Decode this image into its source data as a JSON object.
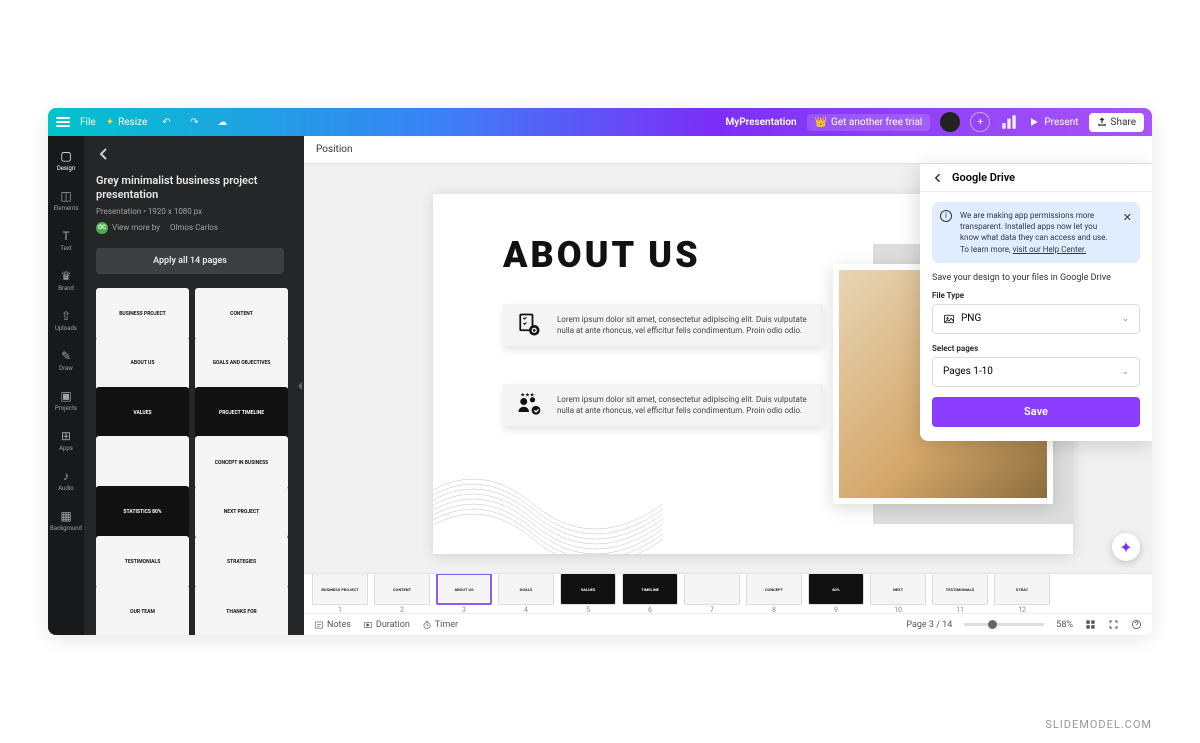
{
  "topbar": {
    "file": "File",
    "resize": "Resize",
    "doc_title": "MyPresentation",
    "trial": "Get another free trial",
    "present": "Present",
    "share": "Share"
  },
  "rail": {
    "items": [
      {
        "label": "Design"
      },
      {
        "label": "Elements"
      },
      {
        "label": "Text"
      },
      {
        "label": "Brand"
      },
      {
        "label": "Uploads"
      },
      {
        "label": "Draw"
      },
      {
        "label": "Projects"
      },
      {
        "label": "Apps"
      },
      {
        "label": "Audio"
      },
      {
        "label": "Background"
      }
    ]
  },
  "panel": {
    "title": "Grey minimalist business project presentation",
    "subtitle": "Presentation • 1920 x 1080 px",
    "author_prefix": "View more by",
    "author": "Olmos Carlos",
    "author_badge": "OC",
    "apply": "Apply all 14 pages",
    "thumbs": [
      {
        "label": "BUSINESS PROJECT",
        "dark": false
      },
      {
        "label": "CONTENT",
        "dark": false
      },
      {
        "label": "ABOUT US",
        "dark": false
      },
      {
        "label": "GOALS AND OBJECTIVES",
        "dark": false
      },
      {
        "label": "VALUES",
        "dark": true
      },
      {
        "label": "PROJECT TIMELINE",
        "dark": true
      },
      {
        "label": "",
        "dark": false
      },
      {
        "label": "CONCEPT IN BUSINESS",
        "dark": false
      },
      {
        "label": "STATISTICS 80%",
        "dark": true
      },
      {
        "label": "NEXT PROJECT",
        "dark": false
      },
      {
        "label": "TESTIMONIALS",
        "dark": false
      },
      {
        "label": "STRATEGIES",
        "dark": false
      },
      {
        "label": "OUR TEAM",
        "dark": false
      },
      {
        "label": "THANKS FOR",
        "dark": false
      }
    ]
  },
  "context": {
    "position": "Position"
  },
  "slide": {
    "heading": "ABOUT US",
    "body": "Lorem ipsum dolor sit amet, consectetur adipiscing elit. Duis vulputate nulla at ante rhoncus, vel efficitur felis condimentum. Proin odio odio."
  },
  "popover": {
    "title": "Google Drive",
    "notice": "We are making app permissions more transparent. Installed apps now let you know what data they can access and use. To learn more,",
    "notice_link": "visit our Help Center.",
    "desc": "Save your design to your files in Google Drive",
    "filetype_label": "File Type",
    "filetype_value": "PNG",
    "pages_label": "Select pages",
    "pages_value": "Pages 1-10",
    "save": "Save"
  },
  "film": [
    {
      "n": "1",
      "label": "BUSINESS PROJECT",
      "dark": false
    },
    {
      "n": "2",
      "label": "CONTENT",
      "dark": false
    },
    {
      "n": "3",
      "label": "ABOUT US",
      "dark": false,
      "active": true
    },
    {
      "n": "4",
      "label": "GOALS",
      "dark": false
    },
    {
      "n": "5",
      "label": "VALUES",
      "dark": true
    },
    {
      "n": "6",
      "label": "TIMELINE",
      "dark": true
    },
    {
      "n": "7",
      "label": "",
      "dark": false
    },
    {
      "n": "8",
      "label": "CONCEPT",
      "dark": false
    },
    {
      "n": "9",
      "label": "80%",
      "dark": true
    },
    {
      "n": "10",
      "label": "NEXT",
      "dark": false
    },
    {
      "n": "11",
      "label": "TESTIMONIALS",
      "dark": false
    },
    {
      "n": "12",
      "label": "STRAT",
      "dark": false
    }
  ],
  "status": {
    "notes": "Notes",
    "duration": "Duration",
    "timer": "Timer",
    "page": "Page 3 / 14",
    "zoom": "58%"
  },
  "watermark": "SLIDEMODEL.COM"
}
